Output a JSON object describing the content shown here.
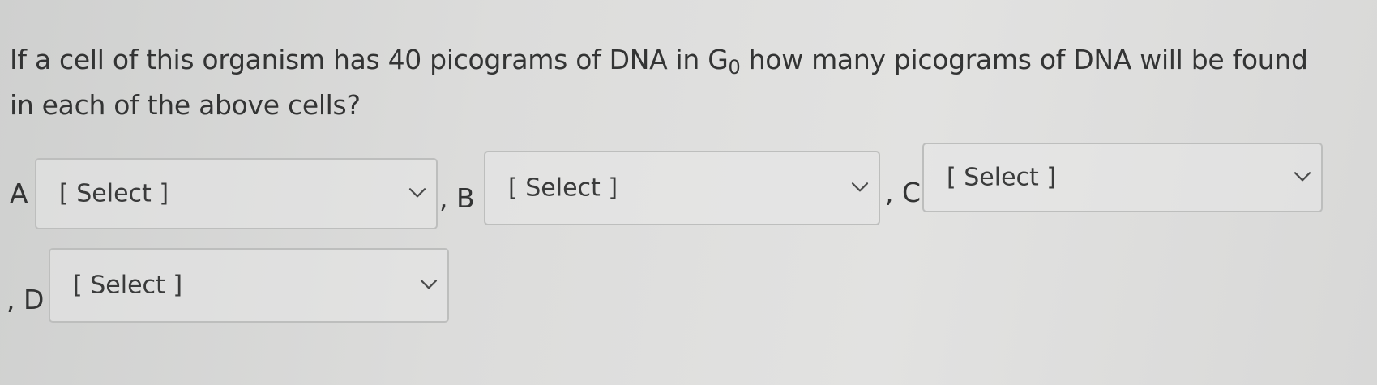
{
  "question": {
    "text_before": "If a cell of this organism has 40 picograms of DNA in G",
    "subscript": "0",
    "text_after": " how many picograms of DNA will be found in each of the above cells?"
  },
  "blanks": [
    {
      "prefix": "A",
      "value": "[ Select ]"
    },
    {
      "prefix": ", B",
      "value": "[ Select ]"
    },
    {
      "prefix": ", C",
      "value": "[ Select ]"
    },
    {
      "prefix": ", D",
      "value": "[ Select ]"
    }
  ],
  "icons": {
    "dropdown": "chevron-down-icon"
  }
}
